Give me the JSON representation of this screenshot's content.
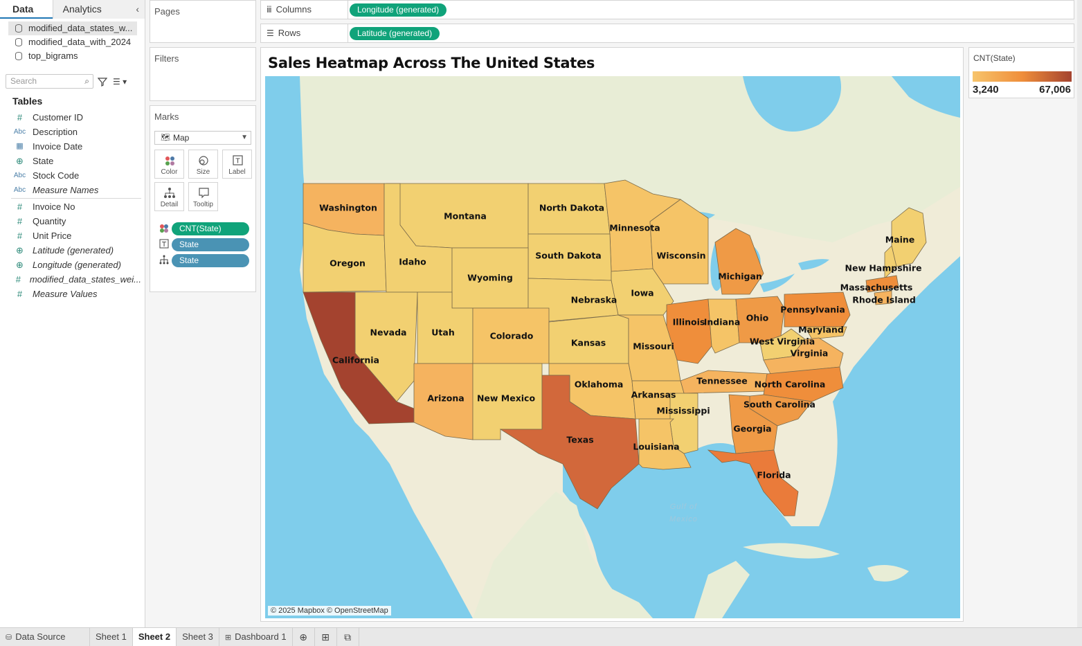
{
  "data_pane": {
    "tabs": [
      "Data",
      "Analytics"
    ],
    "collapse_icon": "chevron-left-icon",
    "data_sources": [
      "modified_data_states_w...",
      "modified_data_with_2024",
      "top_bigrams"
    ],
    "search_placeholder": "Search",
    "tables_header": "Tables",
    "fields_dimensions": [
      {
        "name": "Customer ID",
        "type": "#"
      },
      {
        "name": "Description",
        "type": "Abc"
      },
      {
        "name": "Invoice Date",
        "type": "date"
      },
      {
        "name": "State",
        "type": "geo"
      },
      {
        "name": "Stock Code",
        "type": "Abc"
      },
      {
        "name": "Measure Names",
        "type": "Abc"
      }
    ],
    "fields_measures": [
      {
        "name": "Invoice No",
        "type": "#"
      },
      {
        "name": "Quantity",
        "type": "#"
      },
      {
        "name": "Unit Price",
        "type": "#"
      },
      {
        "name": "Latitude (generated)",
        "type": "geo"
      },
      {
        "name": "Longitude (generated)",
        "type": "geo"
      },
      {
        "name": "modified_data_states_wei...",
        "type": "#"
      },
      {
        "name": "Measure Values",
        "type": "#"
      }
    ]
  },
  "pages": {
    "title": "Pages"
  },
  "filters": {
    "title": "Filters"
  },
  "marks": {
    "title": "Marks",
    "type": "Map",
    "buttons": [
      "Color",
      "Size",
      "Label",
      "Detail",
      "Tooltip"
    ],
    "pills": [
      {
        "label": "CNT(State)",
        "color": "#10a37a"
      },
      {
        "label": "State",
        "color": "#4a93b4"
      },
      {
        "label": "State",
        "color": "#4a93b4"
      }
    ]
  },
  "shelves": {
    "columns_label": "Columns",
    "columns_pill": "Longitude (generated)",
    "rows_label": "Rows",
    "rows_pill": "Latitude (generated)"
  },
  "viz": {
    "title": "Sales Heatmap Across The United States",
    "credit": "© 2025 Mapbox © OpenStreetMap",
    "gulf_label_1": "Gulf of",
    "gulf_label_2": "Mexico",
    "states": [
      "Washington",
      "Montana",
      "North Dakota",
      "Minnesota",
      "Oregon",
      "Idaho",
      "South Dakota",
      "Wisconsin",
      "Maine",
      "Wyoming",
      "New Hampshire",
      "Michigan",
      "Massachusetts",
      "Iowa",
      "Nebraska",
      "Rhode Island",
      "Pennsylvania",
      "Illinois",
      "Indiana",
      "Ohio",
      "Nevada",
      "Utah",
      "Colorado",
      "Kansas",
      "Missouri",
      "Maryland",
      "West Virginia",
      "California",
      "Virginia",
      "Tennessee",
      "North Carolina",
      "Oklahoma",
      "Arkansas",
      "Arizona",
      "New Mexico",
      "South Carolina",
      "Mississippi",
      "Georgia",
      "Texas",
      "Louisiana",
      "Florida"
    ]
  },
  "legend": {
    "title": "CNT(State)",
    "min": "3,240",
    "max": "67,006",
    "color_low": "#f7c46b",
    "color_high": "#a4432f"
  },
  "bottom_tabs": [
    "Data Source",
    "Sheet 1",
    "Sheet 2",
    "Sheet 3",
    "Dashboard 1"
  ],
  "active_tab": "Sheet 2"
}
